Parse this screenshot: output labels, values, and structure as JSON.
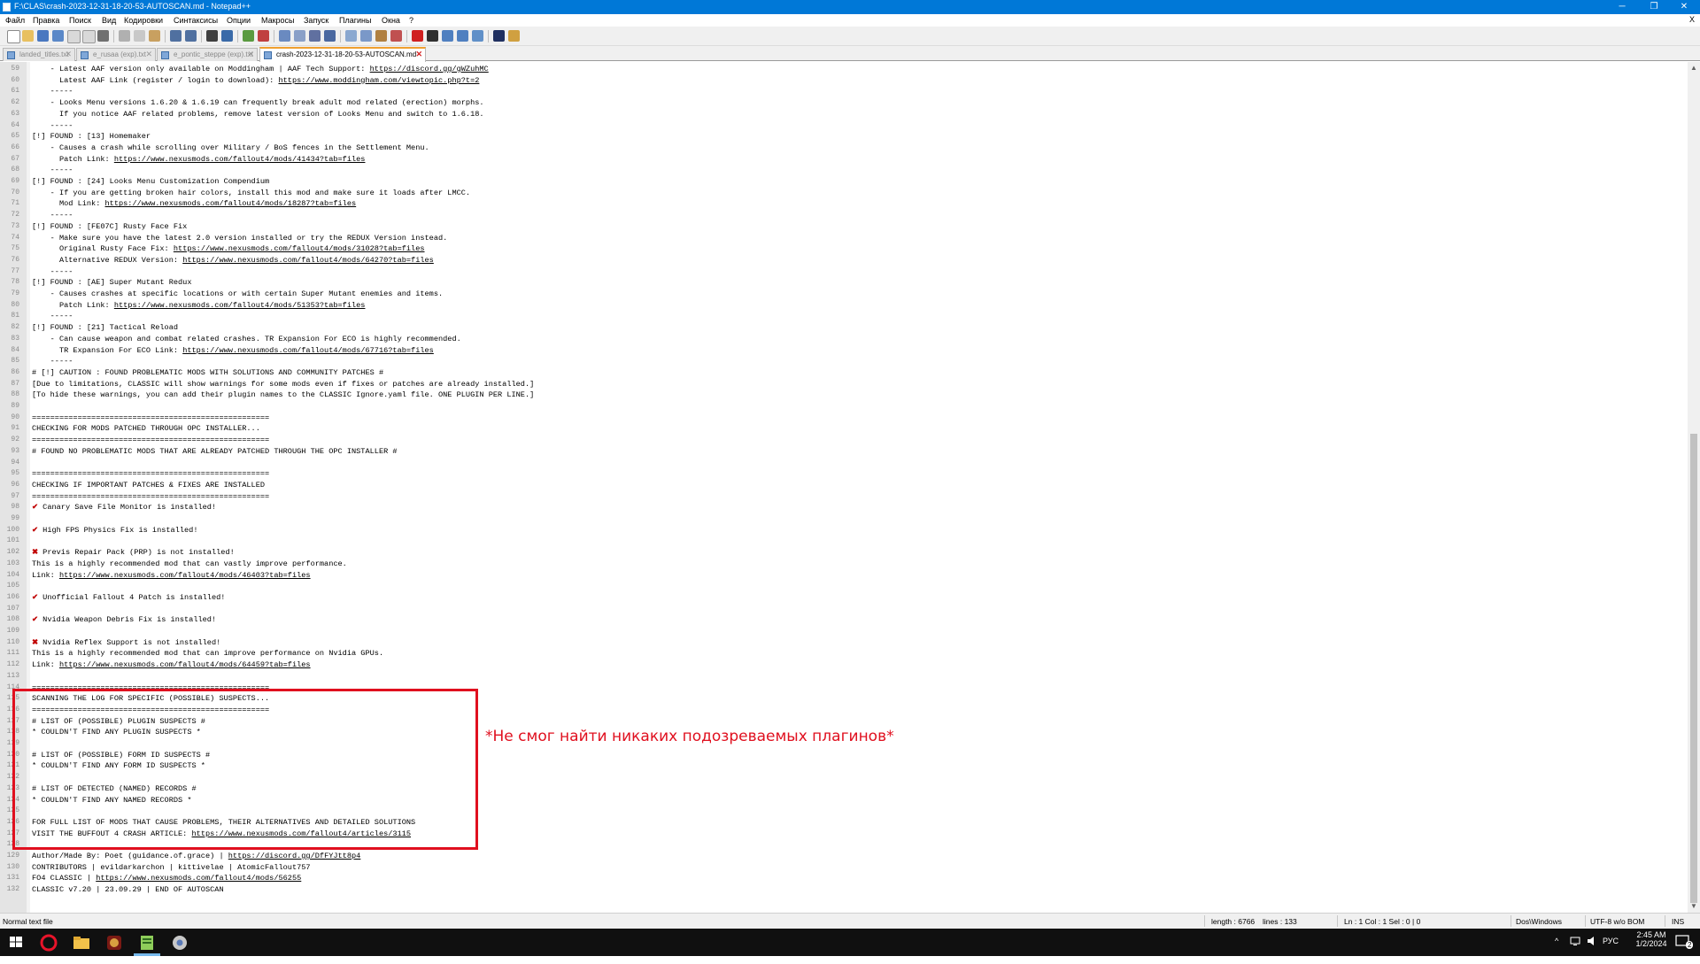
{
  "window": {
    "title": "F:\\CLAS\\crash-2023-12-31-18-20-53-AUTOSCAN.md - Notepad++",
    "controls": {
      "minimize": "─",
      "maximize": "❐",
      "close": "✕"
    }
  },
  "menu": [
    "Файл",
    "Правка",
    "Поиск",
    "Вид",
    "Кодировки",
    "Синтаксисы",
    "Опции",
    "Макросы",
    "Запуск",
    "Плагины",
    "Окна",
    "?"
  ],
  "menu_close": "X",
  "tabs": [
    {
      "label": "landed_titles.txt",
      "active": false
    },
    {
      "label": "e_rusaa (exp).txt",
      "active": false
    },
    {
      "label": "e_pontic_steppe (exp).txt",
      "active": false
    },
    {
      "label": "crash-2023-12-31-18-20-53-AUTOSCAN.md",
      "active": true
    }
  ],
  "tab_close": "✕",
  "editor": {
    "lines": [
      {
        "n": "59",
        "t": "    - Latest AAF version only available on Moddingham | AAF Tech Support: ",
        "l": "https://discord.gg/gWZuhMC",
        "s": ""
      },
      {
        "n": "60",
        "t": "      Latest AAF Link (register / login to download): ",
        "l": "https://www.moddingham.com/viewtopic.php?t=2",
        "s": ""
      },
      {
        "n": "61",
        "t": "    -----",
        "l": "",
        "s": ""
      },
      {
        "n": "62",
        "t": "    - Looks Menu versions 1.6.20 & 1.6.19 can frequently break adult mod related (erection) morphs.",
        "l": "",
        "s": ""
      },
      {
        "n": "63",
        "t": "      If you notice AAF related problems, remove latest version of Looks Menu and switch to 1.6.18.",
        "l": "",
        "s": ""
      },
      {
        "n": "64",
        "t": "    -----",
        "l": "",
        "s": ""
      },
      {
        "n": "65",
        "t": "[!] FOUND : [13] Homemaker",
        "l": "",
        "s": ""
      },
      {
        "n": "66",
        "t": "    - Causes a crash while scrolling over Military / BoS fences in the Settlement Menu.",
        "l": "",
        "s": ""
      },
      {
        "n": "67",
        "t": "      Patch Link: ",
        "l": "https://www.nexusmods.com/fallout4/mods/41434?tab=files",
        "s": ""
      },
      {
        "n": "68",
        "t": "    -----",
        "l": "",
        "s": ""
      },
      {
        "n": "69",
        "t": "[!] FOUND : [24] Looks Menu Customization Compendium",
        "l": "",
        "s": ""
      },
      {
        "n": "70",
        "t": "    - If you are getting broken hair colors, install this mod and make sure it loads after LMCC.",
        "l": "",
        "s": ""
      },
      {
        "n": "71",
        "t": "      Mod Link: ",
        "l": "https://www.nexusmods.com/fallout4/mods/18287?tab=files",
        "s": ""
      },
      {
        "n": "72",
        "t": "    -----",
        "l": "",
        "s": ""
      },
      {
        "n": "73",
        "t": "[!] FOUND : [FE07C] Rusty Face Fix",
        "l": "",
        "s": ""
      },
      {
        "n": "74",
        "t": "    - Make sure you have the latest 2.0 version installed or try the REDUX Version instead.",
        "l": "",
        "s": ""
      },
      {
        "n": "75",
        "t": "      Original Rusty Face Fix: ",
        "l": "https://www.nexusmods.com/fallout4/mods/31028?tab=files",
        "s": ""
      },
      {
        "n": "76",
        "t": "      Alternative REDUX Version: ",
        "l": "https://www.nexusmods.com/fallout4/mods/64270?tab=files",
        "s": ""
      },
      {
        "n": "77",
        "t": "    -----",
        "l": "",
        "s": ""
      },
      {
        "n": "78",
        "t": "[!] FOUND : [AE] Super Mutant Redux",
        "l": "",
        "s": ""
      },
      {
        "n": "79",
        "t": "    - Causes crashes at specific locations or with certain Super Mutant enemies and items.",
        "l": "",
        "s": ""
      },
      {
        "n": "80",
        "t": "      Patch Link: ",
        "l": "https://www.nexusmods.com/fallout4/mods/51353?tab=files",
        "s": ""
      },
      {
        "n": "81",
        "t": "    -----",
        "l": "",
        "s": ""
      },
      {
        "n": "82",
        "t": "[!] FOUND : [21] Tactical Reload",
        "l": "",
        "s": ""
      },
      {
        "n": "83",
        "t": "    - Can cause weapon and combat related crashes. TR Expansion For ECO is highly recommended.",
        "l": "",
        "s": ""
      },
      {
        "n": "84",
        "t": "      TR Expansion For ECO Link: ",
        "l": "https://www.nexusmods.com/fallout4/mods/67716?tab=files",
        "s": ""
      },
      {
        "n": "85",
        "t": "    -----",
        "l": "",
        "s": ""
      },
      {
        "n": "86",
        "t": "# [!] CAUTION : FOUND PROBLEMATIC MODS WITH SOLUTIONS AND COMMUNITY PATCHES #",
        "l": "",
        "s": ""
      },
      {
        "n": "87",
        "t": "[Due to limitations, CLASSIC will show warnings for some mods even if fixes or patches are already installed.]",
        "l": "",
        "s": ""
      },
      {
        "n": "88",
        "t": "[To hide these warnings, you can add their plugin names to the CLASSIC Ignore.yaml file. ONE PLUGIN PER LINE.]",
        "l": "",
        "s": ""
      },
      {
        "n": "89",
        "t": "",
        "l": "",
        "s": ""
      },
      {
        "n": "90",
        "t": "====================================================",
        "l": "",
        "s": ""
      },
      {
        "n": "91",
        "t": "CHECKING FOR MODS PATCHED THROUGH OPC INSTALLER...",
        "l": "",
        "s": ""
      },
      {
        "n": "92",
        "t": "====================================================",
        "l": "",
        "s": ""
      },
      {
        "n": "93",
        "t": "# FOUND NO PROBLEMATIC MODS THAT ARE ALREADY PATCHED THROUGH THE OPC INSTALLER #",
        "l": "",
        "s": ""
      },
      {
        "n": "94",
        "t": "",
        "l": "",
        "s": ""
      },
      {
        "n": "95",
        "t": "====================================================",
        "l": "",
        "s": ""
      },
      {
        "n": "96",
        "t": "CHECKING IF IMPORTANT PATCHES & FIXES ARE INSTALLED",
        "l": "",
        "s": ""
      },
      {
        "n": "97",
        "t": "====================================================",
        "l": "",
        "s": ""
      },
      {
        "n": "98",
        "t": " Canary Save File Monitor is installed!",
        "l": "",
        "s": "✔"
      },
      {
        "n": "99",
        "t": "",
        "l": "",
        "s": ""
      },
      {
        "n": "100",
        "t": " High FPS Physics Fix is installed!",
        "l": "",
        "s": "✔"
      },
      {
        "n": "101",
        "t": "",
        "l": "",
        "s": ""
      },
      {
        "n": "102",
        "t": " Previs Repair Pack (PRP) is not installed!",
        "l": "",
        "s": "✖"
      },
      {
        "n": "103",
        "t": "This is a highly recommended mod that can vastly improve performance.",
        "l": "",
        "s": ""
      },
      {
        "n": "104",
        "t": "Link: ",
        "l": "https://www.nexusmods.com/fallout4/mods/46403?tab=files",
        "s": ""
      },
      {
        "n": "105",
        "t": "",
        "l": "",
        "s": ""
      },
      {
        "n": "106",
        "t": " Unofficial Fallout 4 Patch is installed!",
        "l": "",
        "s": "✔"
      },
      {
        "n": "107",
        "t": "",
        "l": "",
        "s": ""
      },
      {
        "n": "108",
        "t": " Nvidia Weapon Debris Fix is installed!",
        "l": "",
        "s": "✔"
      },
      {
        "n": "109",
        "t": "",
        "l": "",
        "s": ""
      },
      {
        "n": "110",
        "t": " Nvidia Reflex Support is not installed!",
        "l": "",
        "s": "✖"
      },
      {
        "n": "111",
        "t": "This is a highly recommended mod that can improve performance on Nvidia GPUs.",
        "l": "",
        "s": ""
      },
      {
        "n": "112",
        "t": "Link: ",
        "l": "https://www.nexusmods.com/fallout4/mods/64459?tab=files",
        "s": ""
      },
      {
        "n": "113",
        "t": "",
        "l": "",
        "s": ""
      },
      {
        "n": "114",
        "t": "====================================================",
        "l": "",
        "s": ""
      },
      {
        "n": "115",
        "t": "SCANNING THE LOG FOR SPECIFIC (POSSIBLE) SUSPECTS...",
        "l": "",
        "s": ""
      },
      {
        "n": "116",
        "t": "====================================================",
        "l": "",
        "s": ""
      },
      {
        "n": "117",
        "t": "# LIST OF (POSSIBLE) PLUGIN SUSPECTS #",
        "l": "",
        "s": ""
      },
      {
        "n": "118",
        "t": "* COULDN'T FIND ANY PLUGIN SUSPECTS *",
        "l": "",
        "s": ""
      },
      {
        "n": "119",
        "t": "",
        "l": "",
        "s": ""
      },
      {
        "n": "120",
        "t": "# LIST OF (POSSIBLE) FORM ID SUSPECTS #",
        "l": "",
        "s": ""
      },
      {
        "n": "121",
        "t": "* COULDN'T FIND ANY FORM ID SUSPECTS *",
        "l": "",
        "s": ""
      },
      {
        "n": "122",
        "t": "",
        "l": "",
        "s": ""
      },
      {
        "n": "123",
        "t": "# LIST OF DETECTED (NAMED) RECORDS #",
        "l": "",
        "s": ""
      },
      {
        "n": "124",
        "t": "* COULDN'T FIND ANY NAMED RECORDS *",
        "l": "",
        "s": ""
      },
      {
        "n": "125",
        "t": "",
        "l": "",
        "s": ""
      },
      {
        "n": "126",
        "t": "FOR FULL LIST OF MODS THAT CAUSE PROBLEMS, THEIR ALTERNATIVES AND DETAILED SOLUTIONS",
        "l": "",
        "s": ""
      },
      {
        "n": "127",
        "t": "VISIT THE BUFFOUT 4 CRASH ARTICLE: ",
        "l": "https://www.nexusmods.com/fallout4/articles/3115",
        "s": ""
      },
      {
        "n": "128",
        "t": "",
        "l": "",
        "s": ""
      },
      {
        "n": "129",
        "t": "Author/Made By: Poet (guidance.of.grace) | ",
        "l": "https://discord.gg/DfFYJtt8p4",
        "s": ""
      },
      {
        "n": "130",
        "t": "CONTRIBUTORS | evildarkarchon | kittivelae | AtomicFallout757",
        "l": "",
        "s": ""
      },
      {
        "n": "131",
        "t": "FO4 CLASSIC | ",
        "l": "https://www.nexusmods.com/fallout4/mods/56255",
        "s": ""
      },
      {
        "n": "132",
        "t": "CLASSIC v7.20 | 23.09.29 | END OF AUTOSCAN",
        "l": "",
        "s": ""
      }
    ]
  },
  "annotation": "*Не смог найти никаких подозреваемых плагинов*",
  "statusbar": {
    "file_type": "Normal text file",
    "length": "length : 6766",
    "lines": "lines : 133",
    "position": "Ln : 1    Col : 1    Sel : 0 | 0",
    "eol": "Dos\\Windows",
    "encoding": "UTF-8 w/o BOM",
    "mode": "INS"
  },
  "taskbar": {
    "language": "РУС",
    "time": "2:45 AM",
    "date": "1/2/2024",
    "notifications": "2",
    "tray_chevron": "^"
  },
  "colors": {
    "titlebar": "#0078d7",
    "annotation_red": "#e0101f",
    "taskbar": "#101010"
  }
}
